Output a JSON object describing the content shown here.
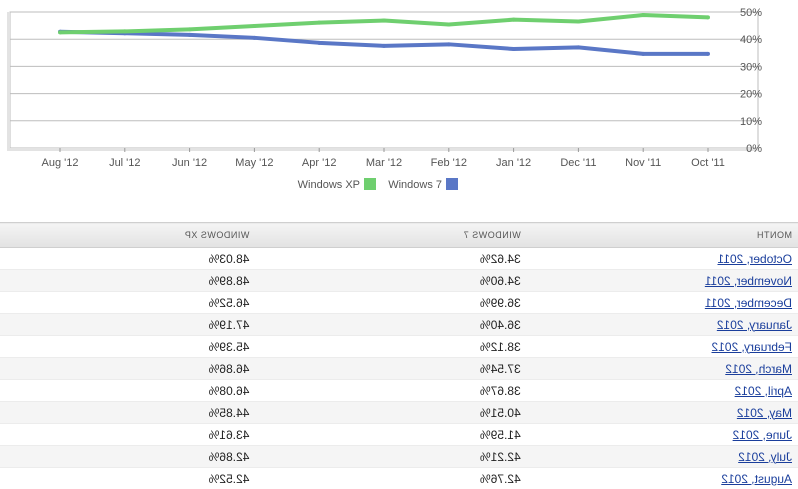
{
  "chart_data": {
    "type": "line",
    "categories": [
      "Oct '11",
      "Nov '11",
      "Dec '11",
      "Jan '12",
      "Feb '12",
      "Mar '12",
      "Apr '12",
      "May '12",
      "Jun '12",
      "Jul '12",
      "Aug '12"
    ],
    "series": [
      {
        "name": "Windows 7",
        "color": "#5a77c6",
        "values": [
          34.62,
          34.6,
          36.99,
          36.4,
          38.12,
          37.54,
          38.67,
          40.51,
          41.59,
          42.21,
          42.76
        ]
      },
      {
        "name": "Windows XP",
        "color": "#6fcf6f",
        "values": [
          48.03,
          48.89,
          46.52,
          47.19,
          45.39,
          46.86,
          46.08,
          44.85,
          43.61,
          42.86,
          42.52
        ]
      }
    ],
    "y_ticks": [
      "0%",
      "10%",
      "20%",
      "30%",
      "40%",
      "50%"
    ],
    "ylim": [
      0,
      50
    ],
    "grid": true,
    "legend_position": "bottom"
  },
  "table": {
    "headers": [
      "MONTH",
      "WINDOWS 7",
      "WINDOWS XP"
    ],
    "rows": [
      {
        "month": "October, 2011",
        "win7": "34.62%",
        "winxp": "48.03%"
      },
      {
        "month": "November, 2011",
        "win7": "34.60%",
        "winxp": "48.89%"
      },
      {
        "month": "December, 2011",
        "win7": "36.99%",
        "winxp": "46.52%"
      },
      {
        "month": "January, 2012",
        "win7": "36.40%",
        "winxp": "47.19%"
      },
      {
        "month": "February, 2012",
        "win7": "38.12%",
        "winxp": "45.39%"
      },
      {
        "month": "March, 2012",
        "win7": "37.54%",
        "winxp": "46.86%"
      },
      {
        "month": "April, 2012",
        "win7": "38.67%",
        "winxp": "46.08%"
      },
      {
        "month": "May, 2012",
        "win7": "40.51%",
        "winxp": "44.85%"
      },
      {
        "month": "June, 2012",
        "win7": "41.59%",
        "winxp": "43.61%"
      },
      {
        "month": "July, 2012",
        "win7": "42.21%",
        "winxp": "42.86%"
      },
      {
        "month": "August, 2012",
        "win7": "42.76%",
        "winxp": "42.52%"
      }
    ]
  }
}
